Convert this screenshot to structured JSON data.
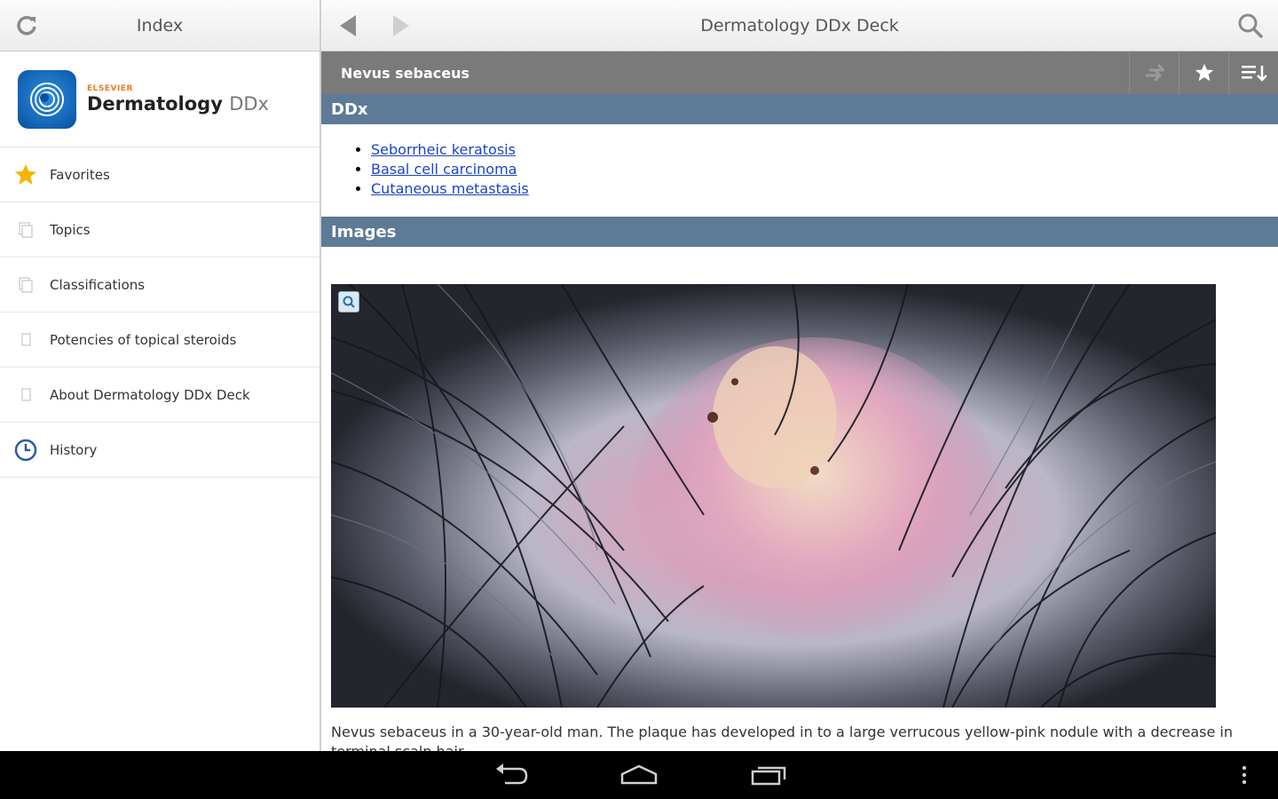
{
  "left_pane": {
    "title": "Index",
    "brand": {
      "publisher": "ELSEVIER",
      "name": "Dermatology",
      "suffix": "DDx"
    },
    "nav": [
      {
        "label": "Favorites",
        "icon": "star-icon"
      },
      {
        "label": "Topics",
        "icon": "pages-icon"
      },
      {
        "label": "Classifications",
        "icon": "pages-icon"
      },
      {
        "label": "Potencies of topical steroids",
        "icon": "page-icon"
      },
      {
        "label": "About Dermatology DDx Deck",
        "icon": "page-icon"
      },
      {
        "label": "History",
        "icon": "clock-icon"
      }
    ]
  },
  "right_pane": {
    "title": "Dermatology DDx Deck",
    "topic": "Nevus sebaceus",
    "sections": {
      "ddx_heading": "DDx",
      "ddx_links": [
        "Seborrheic keratosis",
        "Basal cell carcinoma",
        "Cutaneous metastasis"
      ],
      "images_heading": "Images"
    },
    "caption": "Nevus sebaceus in a 30-year-old man. The plaque has developed in to a large verrucous yellow-pink nodule with a decrease in terminal scalp hair."
  },
  "colors": {
    "section_header": "#5d7a96",
    "topic_bar": "#7a7a7a",
    "link": "#1a44c9",
    "favorite_star": "#f5b400",
    "history_icon": "#2a5ca8"
  }
}
